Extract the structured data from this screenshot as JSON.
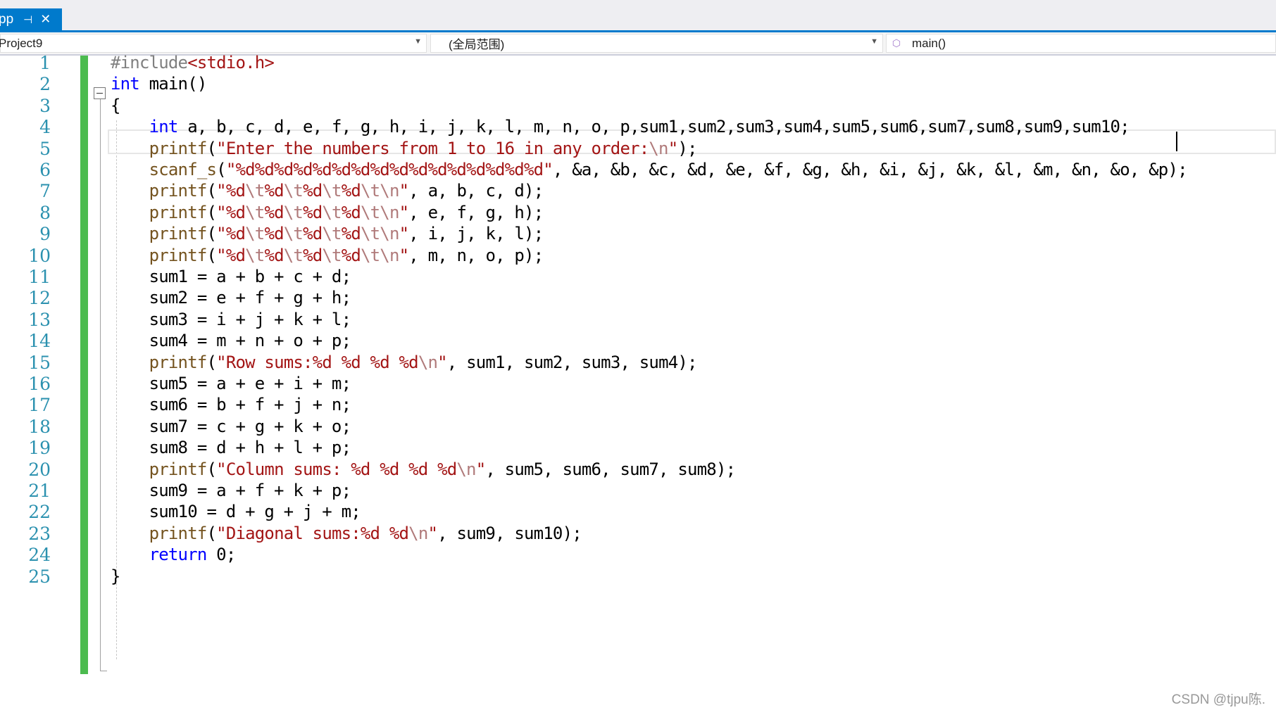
{
  "tab": {
    "name": "pp",
    "pin_glyph": "⊣",
    "close_glyph": "✕"
  },
  "navbar": {
    "project": "Project9",
    "scope": "(全局范围)",
    "member": "main()",
    "member_icon": "cube-icon"
  },
  "editor": {
    "line_numbers": [
      "1",
      "2",
      "3",
      "4",
      "5",
      "6",
      "7",
      "8",
      "9",
      "10",
      "11",
      "12",
      "13",
      "14",
      "15",
      "16",
      "17",
      "18",
      "19",
      "20",
      "21",
      "22",
      "23",
      "24",
      "25"
    ],
    "current_line": 4,
    "lines": [
      [
        {
          "t": "#include",
          "c": "pp"
        },
        {
          "t": "<stdio.h>",
          "c": "hd"
        }
      ],
      [
        {
          "t": "int",
          "c": "kw"
        },
        {
          "t": " main()",
          "c": ""
        }
      ],
      [
        {
          "t": "{",
          "c": ""
        }
      ],
      [
        {
          "t": "    ",
          "c": ""
        },
        {
          "t": "int",
          "c": "kw"
        },
        {
          "t": " a, b, c, d, e, f, g, h, i, j, k, l, m, n, o, p,sum1,sum2,sum3,sum4,sum5,sum6,sum7,sum8,sum9,sum10;",
          "c": ""
        }
      ],
      [
        {
          "t": "    ",
          "c": ""
        },
        {
          "t": "printf",
          "c": "fn"
        },
        {
          "t": "(",
          "c": ""
        },
        {
          "t": "\"Enter the numbers from 1 to 16 in any order:",
          "c": "str"
        },
        {
          "t": "\\n",
          "c": "esc"
        },
        {
          "t": "\"",
          "c": "str"
        },
        {
          "t": ");",
          "c": ""
        }
      ],
      [
        {
          "t": "    ",
          "c": ""
        },
        {
          "t": "scanf_s",
          "c": "fn"
        },
        {
          "t": "(",
          "c": ""
        },
        {
          "t": "\"%d%d%d%d%d%d%d%d%d%d%d%d%d%d%d%d\"",
          "c": "str"
        },
        {
          "t": ", &a, &b, &c, &d, &e, &f, &g, &h, &i, &j, &k, &l, &m, &n, &o, &p);",
          "c": ""
        }
      ],
      [
        {
          "t": "    ",
          "c": ""
        },
        {
          "t": "printf",
          "c": "fn"
        },
        {
          "t": "(",
          "c": ""
        },
        {
          "t": "\"%d",
          "c": "str"
        },
        {
          "t": "\\t",
          "c": "esc"
        },
        {
          "t": "%d",
          "c": "str"
        },
        {
          "t": "\\t",
          "c": "esc"
        },
        {
          "t": "%d",
          "c": "str"
        },
        {
          "t": "\\t",
          "c": "esc"
        },
        {
          "t": "%d",
          "c": "str"
        },
        {
          "t": "\\t\\n",
          "c": "esc"
        },
        {
          "t": "\"",
          "c": "str"
        },
        {
          "t": ", a, b, c, d);",
          "c": ""
        }
      ],
      [
        {
          "t": "    ",
          "c": ""
        },
        {
          "t": "printf",
          "c": "fn"
        },
        {
          "t": "(",
          "c": ""
        },
        {
          "t": "\"%d",
          "c": "str"
        },
        {
          "t": "\\t",
          "c": "esc"
        },
        {
          "t": "%d",
          "c": "str"
        },
        {
          "t": "\\t",
          "c": "esc"
        },
        {
          "t": "%d",
          "c": "str"
        },
        {
          "t": "\\t",
          "c": "esc"
        },
        {
          "t": "%d",
          "c": "str"
        },
        {
          "t": "\\t\\n",
          "c": "esc"
        },
        {
          "t": "\"",
          "c": "str"
        },
        {
          "t": ", e, f, g, h);",
          "c": ""
        }
      ],
      [
        {
          "t": "    ",
          "c": ""
        },
        {
          "t": "printf",
          "c": "fn"
        },
        {
          "t": "(",
          "c": ""
        },
        {
          "t": "\"%d",
          "c": "str"
        },
        {
          "t": "\\t",
          "c": "esc"
        },
        {
          "t": "%d",
          "c": "str"
        },
        {
          "t": "\\t",
          "c": "esc"
        },
        {
          "t": "%d",
          "c": "str"
        },
        {
          "t": "\\t",
          "c": "esc"
        },
        {
          "t": "%d",
          "c": "str"
        },
        {
          "t": "\\t\\n",
          "c": "esc"
        },
        {
          "t": "\"",
          "c": "str"
        },
        {
          "t": ", i, j, k, l);",
          "c": ""
        }
      ],
      [
        {
          "t": "    ",
          "c": ""
        },
        {
          "t": "printf",
          "c": "fn"
        },
        {
          "t": "(",
          "c": ""
        },
        {
          "t": "\"%d",
          "c": "str"
        },
        {
          "t": "\\t",
          "c": "esc"
        },
        {
          "t": "%d",
          "c": "str"
        },
        {
          "t": "\\t",
          "c": "esc"
        },
        {
          "t": "%d",
          "c": "str"
        },
        {
          "t": "\\t",
          "c": "esc"
        },
        {
          "t": "%d",
          "c": "str"
        },
        {
          "t": "\\t\\n",
          "c": "esc"
        },
        {
          "t": "\"",
          "c": "str"
        },
        {
          "t": ", m, n, o, p);",
          "c": ""
        }
      ],
      [
        {
          "t": "    sum1 = a + b + c + d;",
          "c": ""
        }
      ],
      [
        {
          "t": "    sum2 = e + f + g + h;",
          "c": ""
        }
      ],
      [
        {
          "t": "    sum3 = i + j + k + l;",
          "c": ""
        }
      ],
      [
        {
          "t": "    sum4 = m + n + o + p;",
          "c": ""
        }
      ],
      [
        {
          "t": "    ",
          "c": ""
        },
        {
          "t": "printf",
          "c": "fn"
        },
        {
          "t": "(",
          "c": ""
        },
        {
          "t": "\"Row sums:%d %d %d %d",
          "c": "str"
        },
        {
          "t": "\\n",
          "c": "esc"
        },
        {
          "t": "\"",
          "c": "str"
        },
        {
          "t": ", sum1, sum2, sum3, sum4);",
          "c": ""
        }
      ],
      [
        {
          "t": "    sum5 = a + e + i + m;",
          "c": ""
        }
      ],
      [
        {
          "t": "    sum6 = b + f + j + n;",
          "c": ""
        }
      ],
      [
        {
          "t": "    sum7 = c + g + k + o;",
          "c": ""
        }
      ],
      [
        {
          "t": "    sum8 = d + h + l + p;",
          "c": ""
        }
      ],
      [
        {
          "t": "    ",
          "c": ""
        },
        {
          "t": "printf",
          "c": "fn"
        },
        {
          "t": "(",
          "c": ""
        },
        {
          "t": "\"Column sums: %d %d %d %d",
          "c": "str"
        },
        {
          "t": "\\n",
          "c": "esc"
        },
        {
          "t": "\"",
          "c": "str"
        },
        {
          "t": ", sum5, sum6, sum7, sum8);",
          "c": ""
        }
      ],
      [
        {
          "t": "    sum9 = a + f + k + p;",
          "c": ""
        }
      ],
      [
        {
          "t": "    sum10 = d + g + j + m;",
          "c": ""
        }
      ],
      [
        {
          "t": "    ",
          "c": ""
        },
        {
          "t": "printf",
          "c": "fn"
        },
        {
          "t": "(",
          "c": ""
        },
        {
          "t": "\"Diagonal sums:%d %d",
          "c": "str"
        },
        {
          "t": "\\n",
          "c": "esc"
        },
        {
          "t": "\"",
          "c": "str"
        },
        {
          "t": ", sum9, sum10);",
          "c": ""
        }
      ],
      [
        {
          "t": "    ",
          "c": ""
        },
        {
          "t": "return",
          "c": "kw"
        },
        {
          "t": " 0;",
          "c": ""
        }
      ],
      [
        {
          "t": "}",
          "c": ""
        }
      ]
    ]
  },
  "watermark": "CSDN @tjpu陈."
}
